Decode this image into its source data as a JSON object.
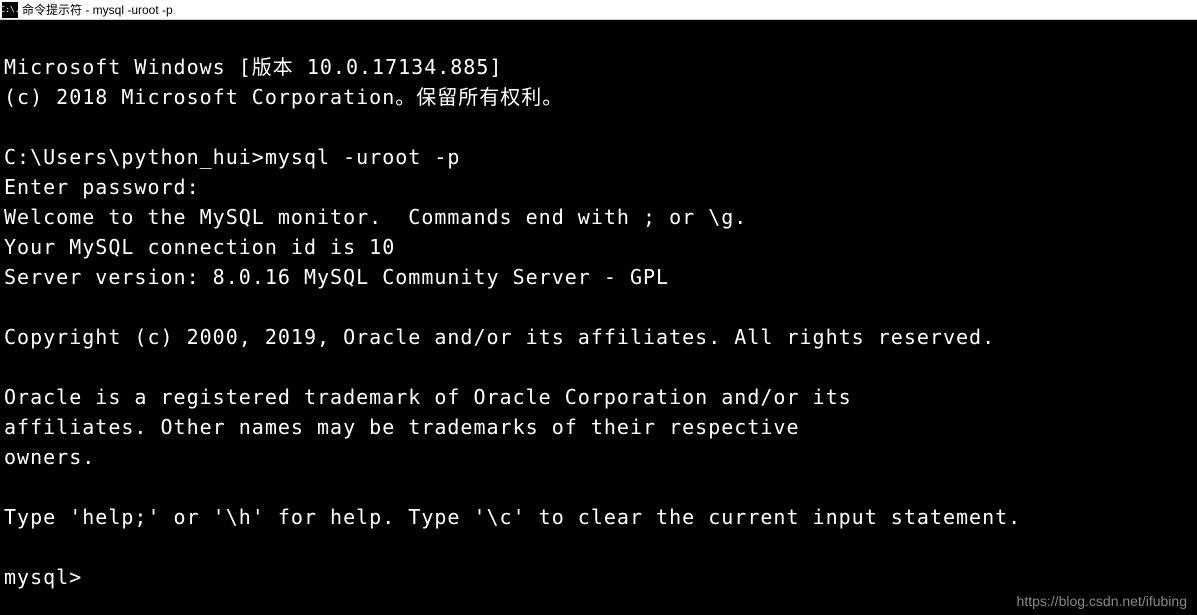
{
  "titlebar": {
    "icon_text": "C:\\.",
    "title": "命令提示符 - mysql  -uroot -p"
  },
  "terminal": {
    "lines": {
      "l1": "Microsoft Windows [版本 10.0.17134.885]",
      "l2": "(c) 2018 Microsoft Corporation。保留所有权利。",
      "l3": "",
      "l4": "C:\\Users\\python_hui>mysql -uroot -p",
      "l5": "Enter password:",
      "l6": "Welcome to the MySQL monitor.  Commands end with ; or \\g.",
      "l7": "Your MySQL connection id is 10",
      "l8": "Server version: 8.0.16 MySQL Community Server - GPL",
      "l9": "",
      "l10": "Copyright (c) 2000, 2019, Oracle and/or its affiliates. All rights reserved.",
      "l11": "",
      "l12": "Oracle is a registered trademark of Oracle Corporation and/or its",
      "l13": "affiliates. Other names may be trademarks of their respective",
      "l14": "owners.",
      "l15": "",
      "l16": "Type 'help;' or '\\h' for help. Type '\\c' to clear the current input statement.",
      "l17": "",
      "l18": "mysql>"
    }
  },
  "watermark": {
    "text": "https://blog.csdn.net/ifubing"
  }
}
